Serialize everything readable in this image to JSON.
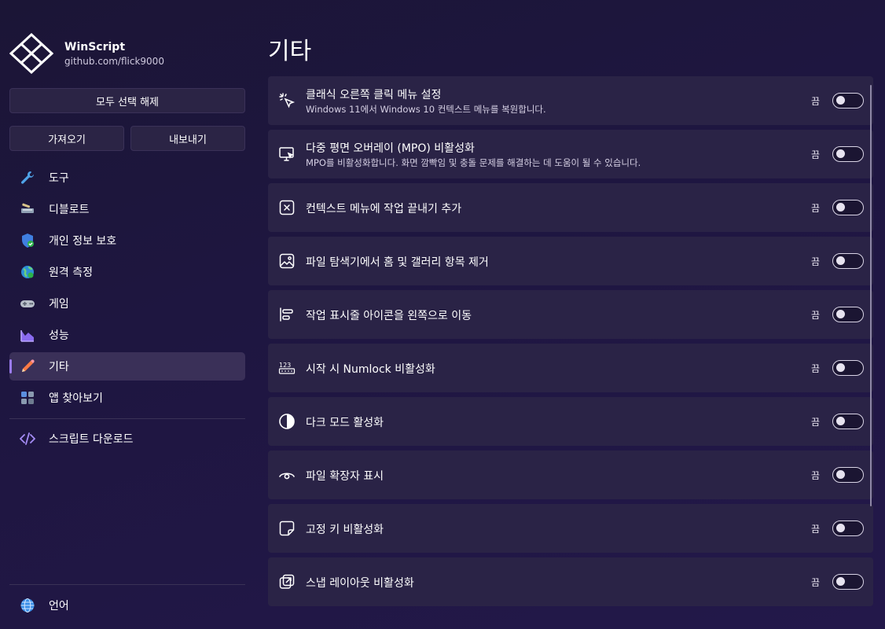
{
  "app": {
    "name": "WinScript",
    "url": "github.com/flick9000"
  },
  "buttons": {
    "deselect_all": "모두 선택 해제",
    "import": "가져오기",
    "export": "내보내기"
  },
  "nav": {
    "items": [
      {
        "label": "도구",
        "icon": "wrench-icon"
      },
      {
        "label": "디블로트",
        "icon": "broom-icon"
      },
      {
        "label": "개인 정보 보호",
        "icon": "shield-icon"
      },
      {
        "label": "원격 측정",
        "icon": "globe-icon"
      },
      {
        "label": "게임",
        "icon": "gamepad-icon"
      },
      {
        "label": "성능",
        "icon": "chart-icon"
      },
      {
        "label": "기타",
        "icon": "pencil-icon",
        "selected": true
      },
      {
        "label": "앱 찾아보기",
        "icon": "apps-icon"
      }
    ],
    "download_scripts": "스크립트 다운로드",
    "language": "언어"
  },
  "page": {
    "title": "기타"
  },
  "settings": [
    {
      "title": "클래식 오른쪽 클릭 메뉴 설정",
      "desc": "Windows 11에서 Windows 10 컨텍스트 메뉴를 복원합니다.",
      "icon": "cursor-click-icon",
      "state": "끔"
    },
    {
      "title": "다중 평면 오버레이 (MPO) 비활성화",
      "desc": "MPO를 비활성화합니다. 화면 깜빡임 및 충돌 문제를 해결하는 데 도움이 될 수 있습니다.",
      "icon": "monitor-icon",
      "state": "끔"
    },
    {
      "title": "컨텍스트 메뉴에 작업 끝내기 추가",
      "desc": "",
      "icon": "close-square-icon",
      "state": "끔"
    },
    {
      "title": "파일 탐색기에서 홈 및 갤러리 항목 제거",
      "desc": "",
      "icon": "image-icon",
      "state": "끔"
    },
    {
      "title": "작업 표시줄 아이콘을 왼쪽으로 이동",
      "desc": "",
      "icon": "align-left-icon",
      "state": "끔"
    },
    {
      "title": "시작 시 Numlock 비활성화",
      "desc": "",
      "icon": "numpad-icon",
      "state": "끔"
    },
    {
      "title": "다크 모드 활성화",
      "desc": "",
      "icon": "contrast-icon",
      "state": "끔"
    },
    {
      "title": "파일 확장자 표시",
      "desc": "",
      "icon": "eye-icon",
      "state": "끔"
    },
    {
      "title": "고정 키 비활성화",
      "desc": "",
      "icon": "sticky-note-icon",
      "state": "끔"
    },
    {
      "title": "스냅 레이아웃 비활성화",
      "desc": "",
      "icon": "snap-layout-icon",
      "state": "끔"
    }
  ]
}
